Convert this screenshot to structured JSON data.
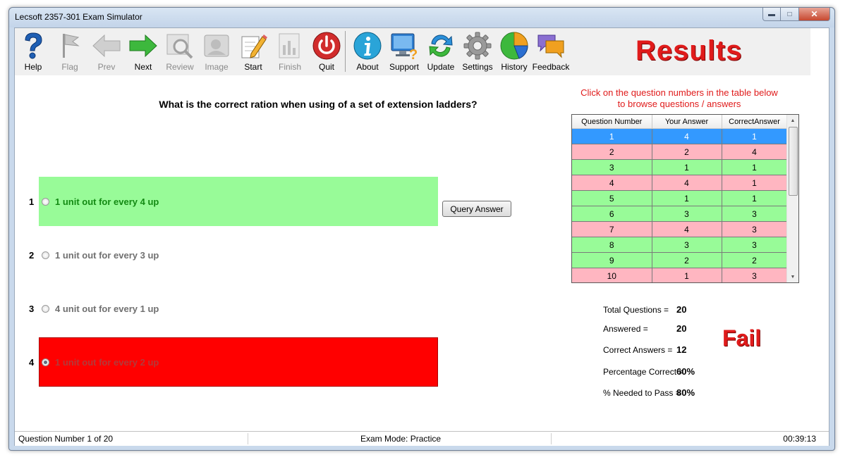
{
  "window": {
    "title": "Lecsoft 2357-301 Exam Simulator",
    "minimize_glyph": "▬",
    "maximize_glyph": "□",
    "close_glyph": "✕"
  },
  "toolbar": {
    "help": "Help",
    "flag": "Flag",
    "prev": "Prev",
    "next": "Next",
    "review": "Review",
    "image": "Image",
    "start": "Start",
    "finish": "Finish",
    "quit": "Quit",
    "about": "About",
    "support": "Support",
    "update": "Update",
    "settings": "Settings",
    "history": "History",
    "feedback": "Feedback",
    "icons": {
      "help": "question-mark-icon",
      "flag": "flag-icon",
      "prev": "arrow-left-icon",
      "next": "arrow-right-icon",
      "review": "magnifier-icon",
      "image": "image-icon",
      "start": "pencil-paper-icon",
      "finish": "finish-icon",
      "quit": "power-icon",
      "about": "info-icon",
      "support": "monitor-question-icon",
      "update": "refresh-icon",
      "settings": "gear-icon",
      "history": "pie-chart-icon",
      "feedback": "speech-bubbles-icon"
    }
  },
  "results_heading": "Results",
  "question": {
    "text": "What is the correct ration when using of a set of extension ladders?",
    "answers": [
      {
        "number": "1",
        "text": "1 unit out for every 4 up",
        "state": "correct"
      },
      {
        "number": "2",
        "text": "1 unit out for every 3 up",
        "state": "neutral"
      },
      {
        "number": "3",
        "text": "4 unit out for every 1 up",
        "state": "neutral"
      },
      {
        "number": "4",
        "text": "1 unit out for every 2 up",
        "state": "wrong-selected"
      }
    ],
    "query_button": "Query Answer"
  },
  "results": {
    "hint_line1": "Click on the question numbers in the table below",
    "hint_line2": "to browse questions / answers",
    "table": {
      "headers": [
        "Question Number",
        "Your Answer",
        "CorrectAnswer"
      ],
      "rows": [
        {
          "q": "1",
          "yours": "4",
          "correct": "1",
          "status": "selected"
        },
        {
          "q": "2",
          "yours": "2",
          "correct": "4",
          "status": "fail"
        },
        {
          "q": "3",
          "yours": "1",
          "correct": "1",
          "status": "pass"
        },
        {
          "q": "4",
          "yours": "4",
          "correct": "1",
          "status": "fail"
        },
        {
          "q": "5",
          "yours": "1",
          "correct": "1",
          "status": "pass"
        },
        {
          "q": "6",
          "yours": "3",
          "correct": "3",
          "status": "pass"
        },
        {
          "q": "7",
          "yours": "4",
          "correct": "3",
          "status": "fail"
        },
        {
          "q": "8",
          "yours": "3",
          "correct": "3",
          "status": "pass"
        },
        {
          "q": "9",
          "yours": "2",
          "correct": "2",
          "status": "pass"
        },
        {
          "q": "10",
          "yours": "1",
          "correct": "3",
          "status": "fail"
        }
      ]
    },
    "stats": {
      "total_label": "Total Questions =",
      "total_value": "20",
      "answered_label": "Answered =",
      "answered_value": "20",
      "correct_label": "Correct Answers =",
      "correct_value": "12",
      "percentage_label": "Percentage Correct =",
      "percentage_value": "60%",
      "needed_label": "% Needed to Pass =",
      "needed_value": "80%"
    },
    "verdict": "Fail"
  },
  "status": {
    "question_number": "Question Number 1 of 20",
    "mode": "Exam Mode: Practice",
    "timer": "00:39:13"
  },
  "colors": {
    "correct_bg": "#98fb98",
    "wrong_bg": "#ff0000",
    "fail_row_bg": "#ffb6c1",
    "selected_row_bg": "#3399ff",
    "accent_red": "#e01b1b"
  }
}
